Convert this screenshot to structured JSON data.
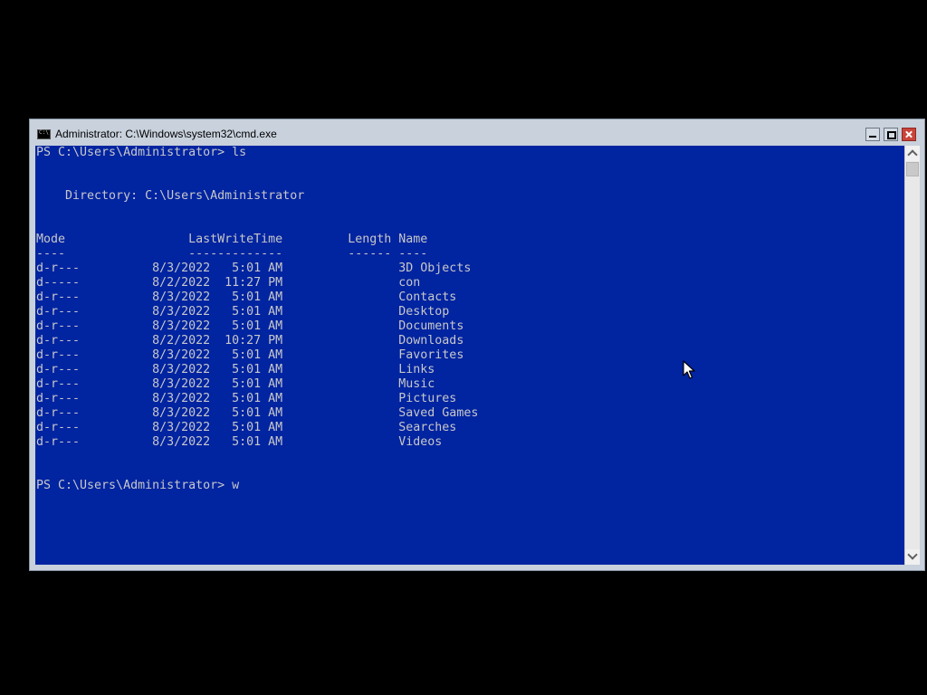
{
  "window": {
    "title": "Administrator: C:\\Windows\\system32\\cmd.exe"
  },
  "console": {
    "lines": [
      "PS C:\\Users\\Administrator> ls",
      "",
      "",
      "    Directory: C:\\Users\\Administrator",
      "",
      "",
      "Mode                 LastWriteTime         Length Name",
      "----                 -------------         ------ ----",
      "d-r---          8/3/2022   5:01 AM                3D Objects",
      "d-----          8/2/2022  11:27 PM                con",
      "d-r---          8/3/2022   5:01 AM                Contacts",
      "d-r---          8/3/2022   5:01 AM                Desktop",
      "d-r---          8/3/2022   5:01 AM                Documents",
      "d-r---          8/2/2022  10:27 PM                Downloads",
      "d-r---          8/3/2022   5:01 AM                Favorites",
      "d-r---          8/3/2022   5:01 AM                Links",
      "d-r---          8/3/2022   5:01 AM                Music",
      "d-r---          8/3/2022   5:01 AM                Pictures",
      "d-r---          8/3/2022   5:01 AM                Saved Games",
      "d-r---          8/3/2022   5:01 AM                Searches",
      "d-r---          8/3/2022   5:01 AM                Videos",
      "",
      "",
      "PS C:\\Users\\Administrator> w"
    ]
  },
  "colors": {
    "console_background": "#0124a1",
    "console_text": "#c8c8c8",
    "titlebar": "#c8d1dc",
    "close_button": "#c9433a"
  },
  "icons": {
    "app": "cmd-icon",
    "minimize": "minimize-icon",
    "maximize": "maximize-icon",
    "close": "close-icon",
    "scroll_up": "scroll-up-arrow-icon",
    "scroll_down": "scroll-down-arrow-icon",
    "pointer": "mouse-pointer-icon"
  }
}
